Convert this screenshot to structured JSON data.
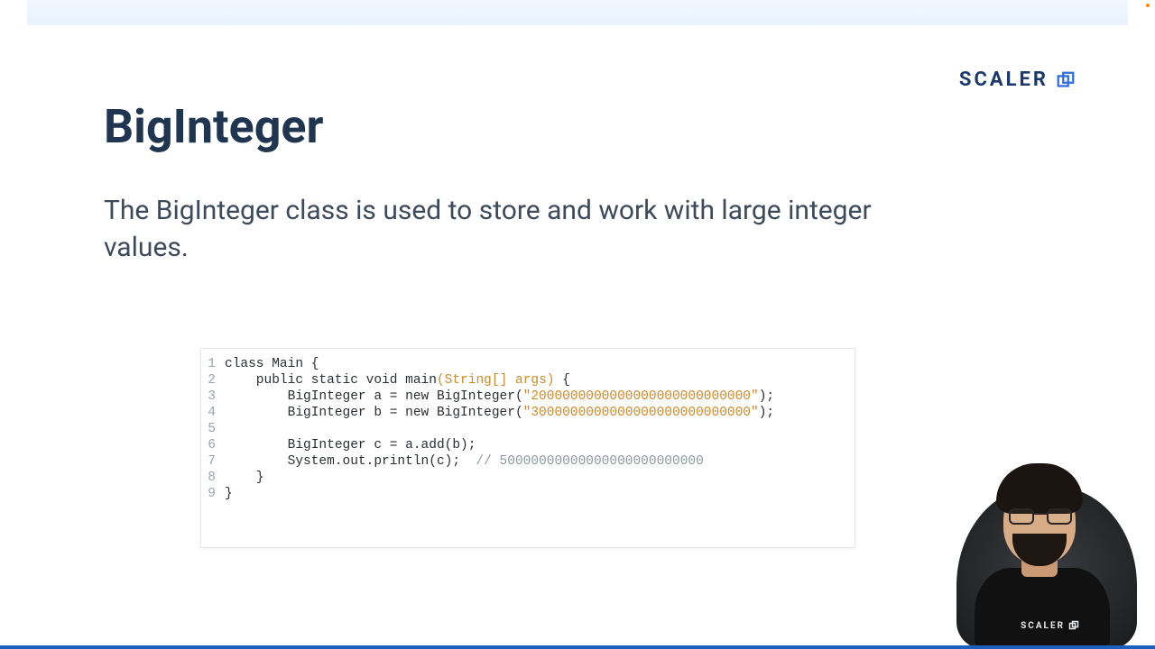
{
  "brand": {
    "name": "SCALER"
  },
  "title": "BigInteger",
  "description": "The BigInteger class is used to store and work with large integer values.",
  "code": {
    "lines": [
      {
        "n": "1",
        "segments": [
          {
            "t": "class Main {",
            "c": "kw"
          }
        ]
      },
      {
        "n": "2",
        "segments": [
          {
            "t": "    public static void main",
            "c": "kw"
          },
          {
            "t": "(String[] args)",
            "c": "param"
          },
          {
            "t": " {",
            "c": "kw"
          }
        ]
      },
      {
        "n": "3",
        "segments": [
          {
            "t": "        BigInteger a = new BigInteger(",
            "c": "kw"
          },
          {
            "t": "\"2000000000000000000000000000\"",
            "c": "str"
          },
          {
            "t": ");",
            "c": "kw"
          }
        ]
      },
      {
        "n": "4",
        "segments": [
          {
            "t": "        BigInteger b = new BigInteger(",
            "c": "kw"
          },
          {
            "t": "\"3000000000000000000000000000\"",
            "c": "str"
          },
          {
            "t": ");",
            "c": "kw"
          }
        ]
      },
      {
        "n": "5",
        "segments": [
          {
            "t": "",
            "c": "kw"
          }
        ]
      },
      {
        "n": "6",
        "segments": [
          {
            "t": "        BigInteger c = a.add(b);",
            "c": "kw"
          }
        ]
      },
      {
        "n": "7",
        "segments": [
          {
            "t": "        System.out.println(c);  ",
            "c": "kw"
          },
          {
            "t": "// 50000000000000000000000000",
            "c": "comment"
          }
        ]
      },
      {
        "n": "8",
        "segments": [
          {
            "t": "    }",
            "c": "kw"
          }
        ]
      },
      {
        "n": "9",
        "segments": [
          {
            "t": "}",
            "c": "kw"
          }
        ]
      }
    ]
  },
  "shirt_logo": "SCALER"
}
